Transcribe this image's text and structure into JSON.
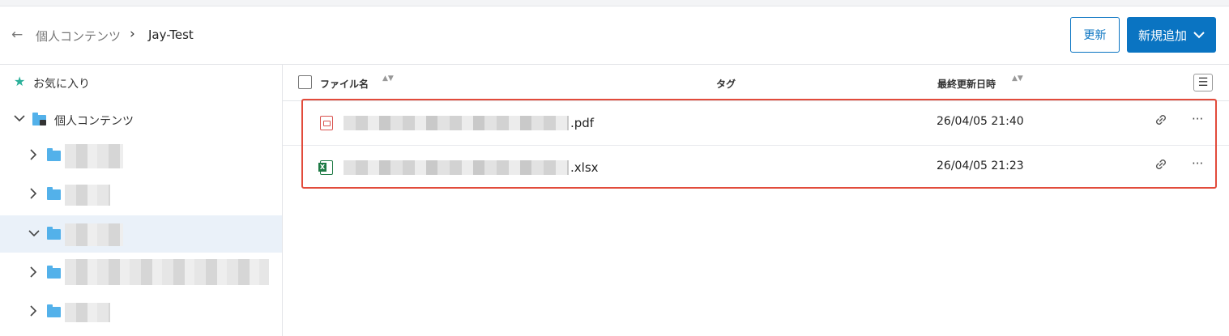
{
  "header": {
    "back_icon": "←",
    "breadcrumb": [
      "個人コンテンツ",
      "Jay-Test"
    ],
    "breadcrumb_separator": "›",
    "refresh_label": "更新",
    "add_label": "新規追加",
    "add_chevron": "⌄"
  },
  "sidebar": {
    "favorites_icon": "★",
    "favorites_label": "お気に入り",
    "personal_label": "個人コンテンツ",
    "chevron_down": "⌵",
    "chevron_right": "›"
  },
  "table": {
    "columns": {
      "name": "ファイル名",
      "tag": "タグ",
      "updated": "最終更新日時"
    },
    "sort_icon": "▲▼",
    "menu_icon": "☰",
    "rows": [
      {
        "ext": ".pdf",
        "date": "26/04/05 21:40",
        "icon": "pdf-icon"
      },
      {
        "ext": ".xlsx",
        "date": "26/04/05 21:23",
        "icon": "excel-icon"
      }
    ],
    "link_icon": "🔗",
    "more_icon": "···"
  },
  "colors": {
    "accent": "#0a74c2",
    "highlight_border": "#e24b3b",
    "folder": "#53b1ea",
    "selected_row": "#eaf1f9"
  }
}
